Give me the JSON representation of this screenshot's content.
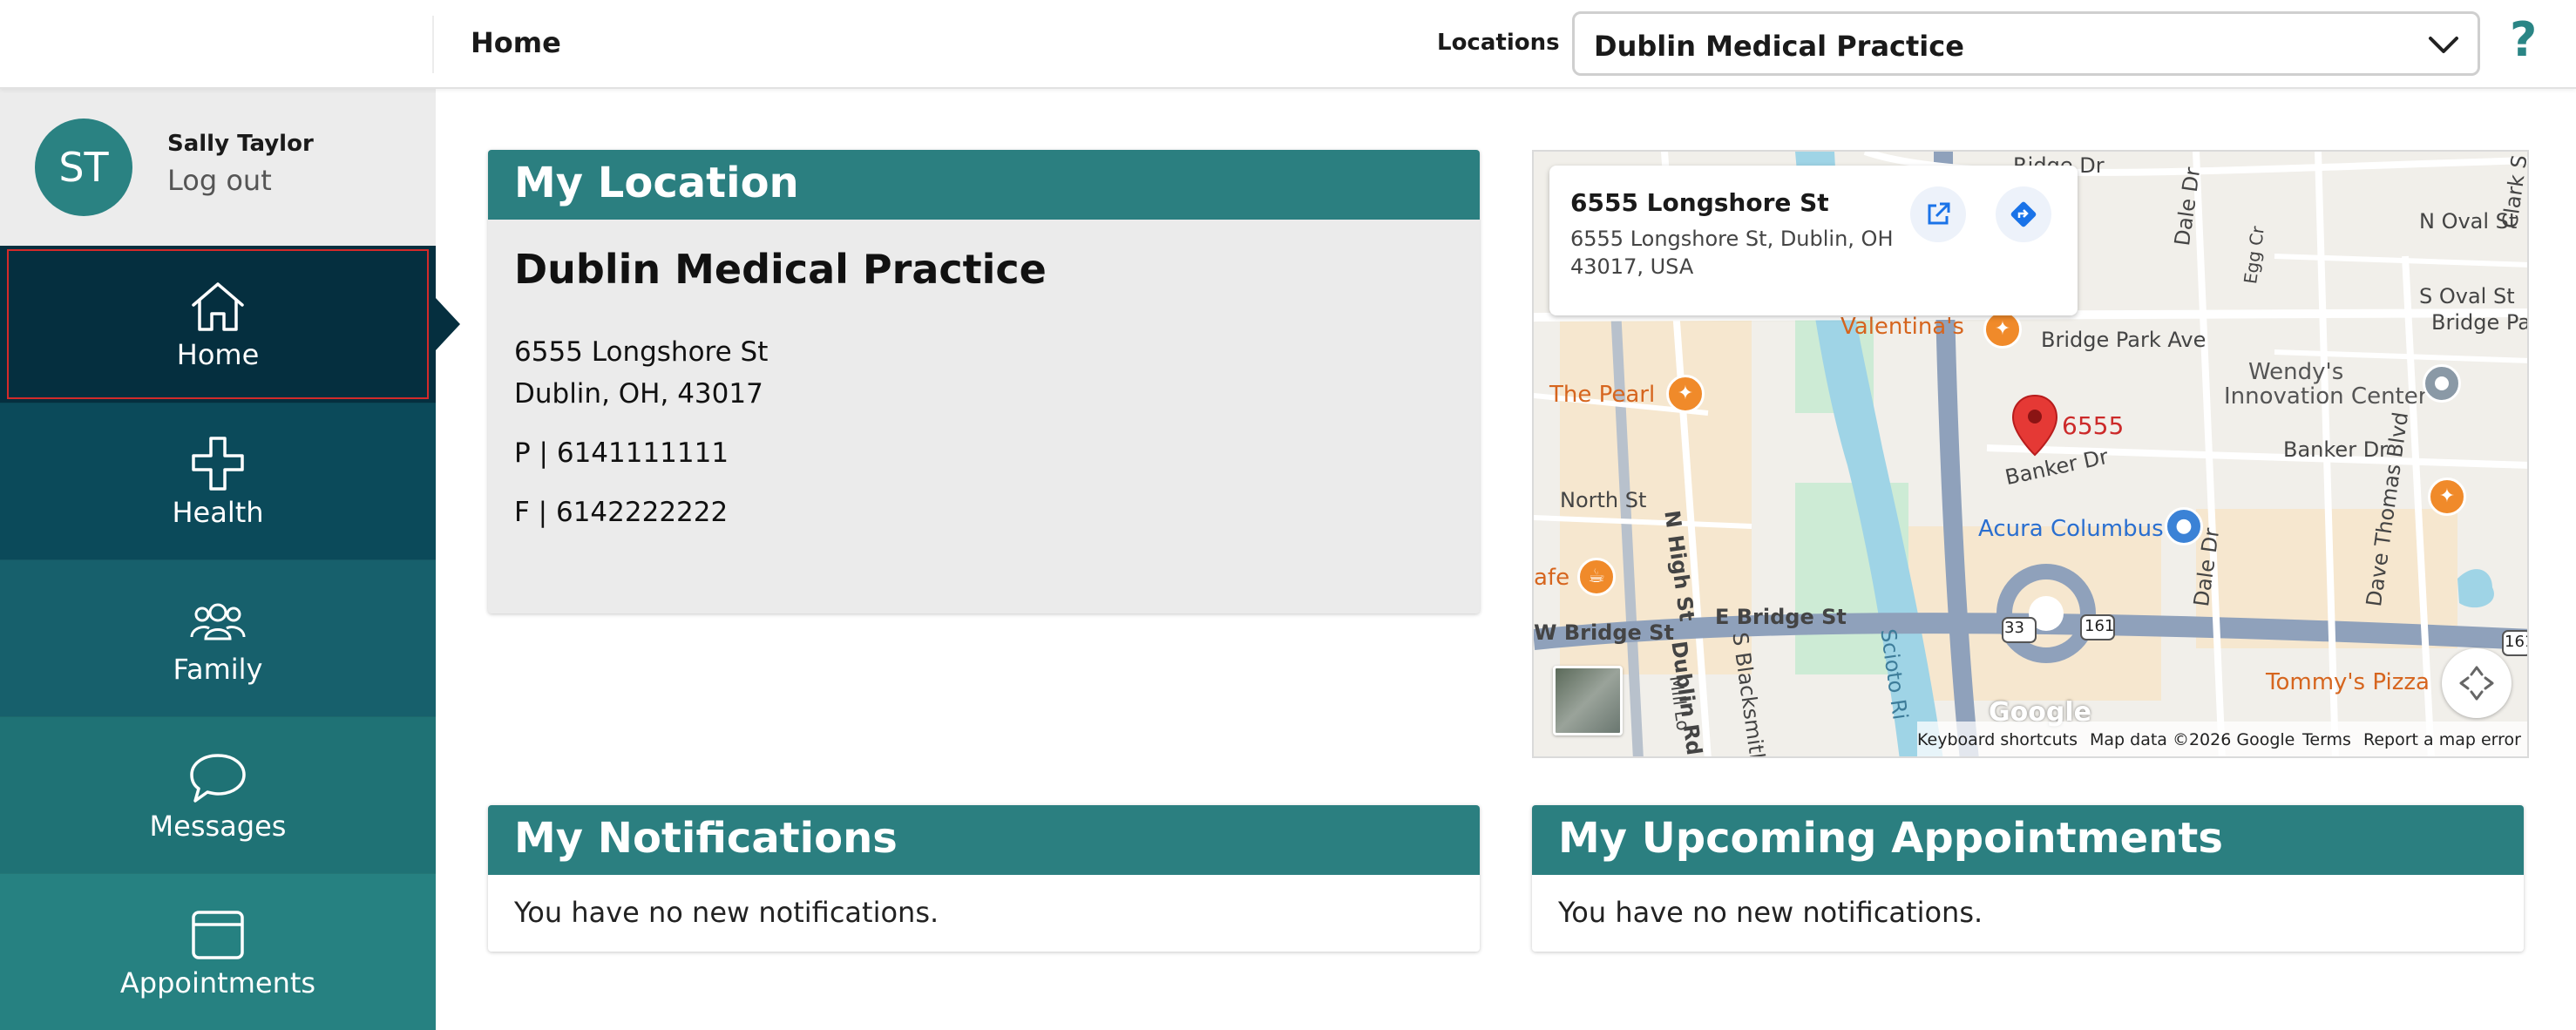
{
  "header": {
    "page_title": "Home",
    "locations_label": "Locations",
    "location_selected": "Dublin Medical Practice",
    "help_icon": "?"
  },
  "user": {
    "initials": "ST",
    "name": "Sally Taylor",
    "logout": "Log out"
  },
  "nav": {
    "items": [
      {
        "label": "Home",
        "icon": "home-icon",
        "active": true
      },
      {
        "label": "Health",
        "icon": "plus-icon"
      },
      {
        "label": "Family",
        "icon": "people-icon"
      },
      {
        "label": "Messages",
        "icon": "speech-bubble-icon"
      },
      {
        "label": "Appointments",
        "icon": "calendar-icon"
      }
    ]
  },
  "location_card": {
    "header": "My Location",
    "name": "Dublin Medical Practice",
    "address_line1": "6555 Longshore St",
    "address_line2": "Dublin, OH, 43017",
    "phone": "P | 6141111111",
    "fax": "F | 6142222222"
  },
  "map": {
    "info_title": "6555 Longshore St",
    "info_address": "6555 Longshore St, Dublin, OH 43017, USA",
    "marker_label": "6555",
    "streets": {
      "bridge_park_ave": "Bridge Park Ave",
      "bridge_park": "Bridge Park",
      "ridge_dr": "Ridge Dr",
      "n_oval_st": "N Oval St",
      "s_oval_st": "S Oval St",
      "banker_dr": "Banker Dr",
      "banker_dr2": "Banker Dr",
      "north_st": "North St",
      "w_bridge_st": "W Bridge St",
      "e_bridge_st": "E Bridge St",
      "n_high_st": "N High St",
      "dublin_rd": "Dublin Rd",
      "s_blacksmith": "S Blacksmith",
      "scioto_ri": "Scioto Ri",
      "dale_dr": "Dale Dr",
      "dale_dr2": "Dale Dr",
      "dave_thomas_blvd": "Dave Thomas Blvd",
      "egg_cr": "Egg Cr",
      "clark_s": "Clark S",
      "mill_lo": "Mill Lo"
    },
    "places": {
      "valentinas": "Valentina's",
      "the_pearl": "The Pearl",
      "wendys": "Wendy's",
      "innovation_center": "Innovation Center",
      "acura": "Acura Columbus",
      "tommys": "Tommy's Pizza",
      "cafe": "afe"
    },
    "route_161": "161",
    "route_33": "33",
    "google": "Google",
    "footer": {
      "shortcuts": "Keyboard shortcuts",
      "map_data": "Map data ©2026 Google",
      "terms": "Terms",
      "report": "Report a map error"
    }
  },
  "notifications_card": {
    "header": "My Notifications",
    "body": "You have no new notifications."
  },
  "appointments_card": {
    "header": "My Upcoming Appointments",
    "body": "You have no new notifications."
  },
  "colors": {
    "accent": "#2b7f80",
    "nav_home": "#052f3f",
    "nav_health": "#0b4a5a",
    "nav_family": "#17606c",
    "nav_messages": "#1f7275",
    "nav_appts": "#268181"
  }
}
